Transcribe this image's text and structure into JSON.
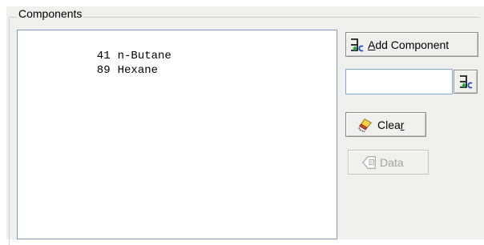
{
  "group": {
    "label": "Components"
  },
  "components": [
    {
      "number": "41",
      "name": "n-Butane"
    },
    {
      "number": "89",
      "name": "Hexane"
    }
  ],
  "buttons": {
    "add_component_label": "Add Component",
    "add_component_accel": "A",
    "add_component_rest": "dd Component",
    "clear_label": "Clear",
    "clear_main": "Clea",
    "clear_accel": "r",
    "data_label": "Data"
  },
  "input": {
    "value": "",
    "placeholder": ""
  },
  "icons": {
    "add_component": "add-component-icon",
    "add_from_input": "add-component-icon",
    "clear": "eraser-icon",
    "data": "tag-icon"
  },
  "colors": {
    "panel_bg": "#f0f0ef",
    "list_border": "#7f9db9",
    "input_border": "#7fa8d9",
    "disabled_text": "#a2a2a2",
    "icon_green": "#1e9e3c",
    "icon_blue": "#1f4fc0"
  }
}
